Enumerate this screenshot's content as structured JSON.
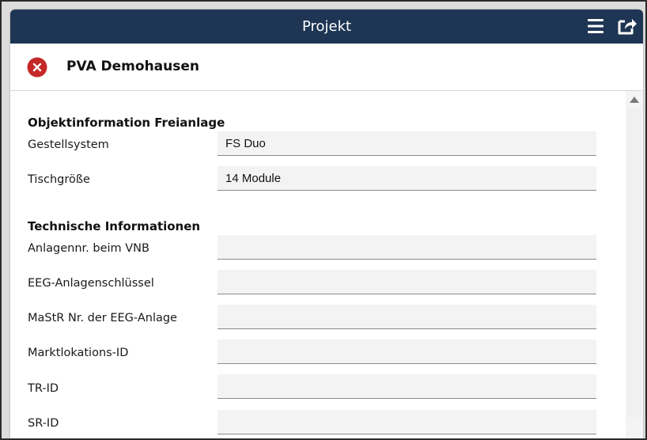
{
  "topbar": {
    "title": "Projekt",
    "menu_icon": "hamburger-menu-icon",
    "share_icon": "share-export-icon",
    "background_color": "#1e3554"
  },
  "project": {
    "name": "PVA Demohausen",
    "close_icon": "close-circle-icon",
    "close_icon_color": "#c62828"
  },
  "sections": [
    {
      "title": "Objektinformation Freianlage",
      "fields": [
        {
          "label": "Gestellsystem",
          "value": "FS Duo"
        },
        {
          "label": "Tischgröße",
          "value": "14 Module"
        }
      ]
    },
    {
      "title": "Technische Informationen",
      "fields": [
        {
          "label": "Anlagennr. beim VNB",
          "value": ""
        },
        {
          "label": "EEG-Anlagenschlüssel",
          "value": ""
        },
        {
          "label": "MaStR Nr. der EEG-Anlage",
          "value": ""
        },
        {
          "label": "Marktlokations-ID",
          "value": ""
        },
        {
          "label": "TR-ID",
          "value": ""
        },
        {
          "label": "SR-ID",
          "value": ""
        }
      ]
    }
  ]
}
